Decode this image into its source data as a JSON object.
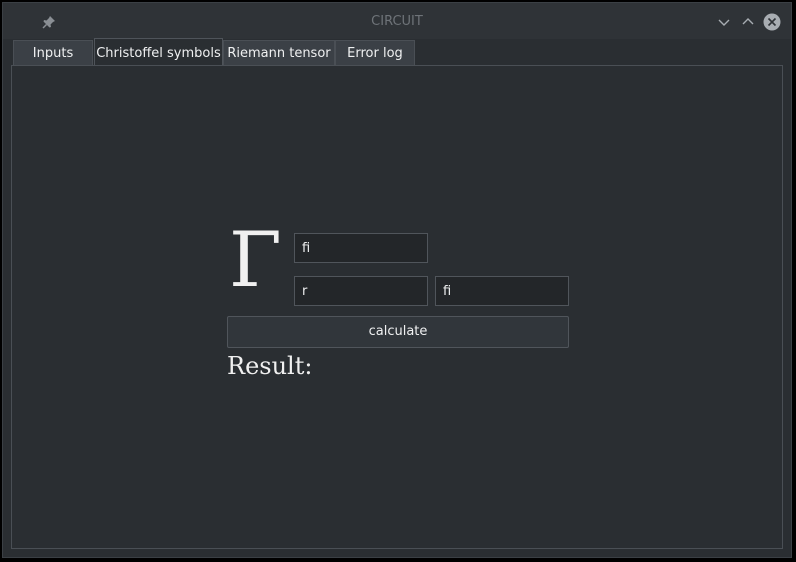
{
  "window": {
    "title": "CIRCUIT",
    "icons": {
      "pin": "pin-icon",
      "minimize": "chevron-down-icon",
      "maximize": "chevron-up-icon",
      "close": "close-icon"
    },
    "colors": {
      "background": "#2a2e32",
      "titlebar": "#2f3337"
    }
  },
  "tabs": [
    {
      "label": "Inputs",
      "active": false
    },
    {
      "label": "Christoffel symbols",
      "active": true
    },
    {
      "label": "Riemann tensor",
      "active": false
    },
    {
      "label": "Error log",
      "active": false
    }
  ],
  "christoffel": {
    "symbol": "Γ",
    "upper_index": "fi",
    "lower_index_1": "r",
    "lower_index_2": "fi",
    "calculate_label": "calculate",
    "result_label": "Result:"
  }
}
